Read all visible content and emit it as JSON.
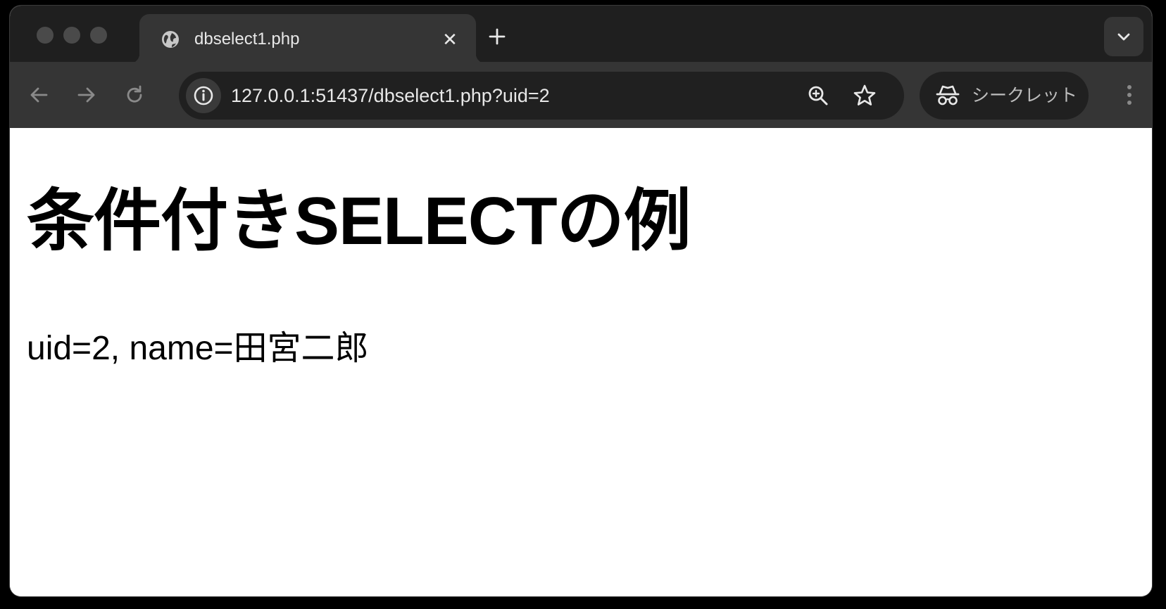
{
  "browser": {
    "tab": {
      "title": "dbselect1.php",
      "favicon": "globe-icon",
      "close": "✕"
    },
    "toolbar": {
      "url": "127.0.0.1:51437/dbselect1.php?uid=2",
      "incognito_label": "シークレット"
    }
  },
  "page": {
    "heading": "条件付きSELECTの例",
    "result": "uid=2, name=田宮二郎"
  },
  "colors": {
    "titlebar": "#1f1f1f",
    "toolbar": "#353535",
    "omnibox": "#202020",
    "page_background": "#ffffff",
    "text": "#000000"
  }
}
